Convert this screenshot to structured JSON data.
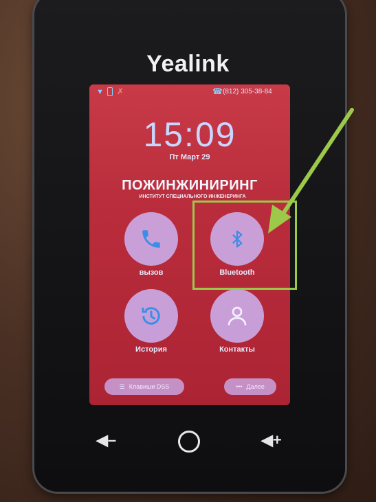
{
  "device": {
    "brand": "Yealink"
  },
  "status_bar": {
    "line_number": "(812) 305-38-84"
  },
  "home": {
    "time": "15:09",
    "date": "Пт Март 29",
    "company": "ПОЖИНЖИНИРИНГ",
    "subtitle": "ИНСТИТУТ СПЕЦИАЛЬНОГО ИНЖЕНЕРИНГА"
  },
  "tiles": [
    {
      "label": "вызов",
      "icon": "phone-icon"
    },
    {
      "label": "Bluetooth",
      "icon": "bluetooth-icon"
    },
    {
      "label": "История",
      "icon": "history-icon"
    },
    {
      "label": "Контакты",
      "icon": "contacts-icon"
    }
  ],
  "bottom_pills": {
    "dss_label": "Клавиши DSS",
    "more_label": "Далее"
  },
  "hardware_buttons": {
    "volume_down_icon": "volume-down-icon",
    "home_icon": "home-icon",
    "volume_up_icon": "volume-up-icon"
  },
  "colors": {
    "screen_red": "#b92c3b",
    "tile_lavender": "#cdb4f5",
    "icon_blue": "#3a8ee8",
    "highlight_green": "#9cc94a"
  }
}
